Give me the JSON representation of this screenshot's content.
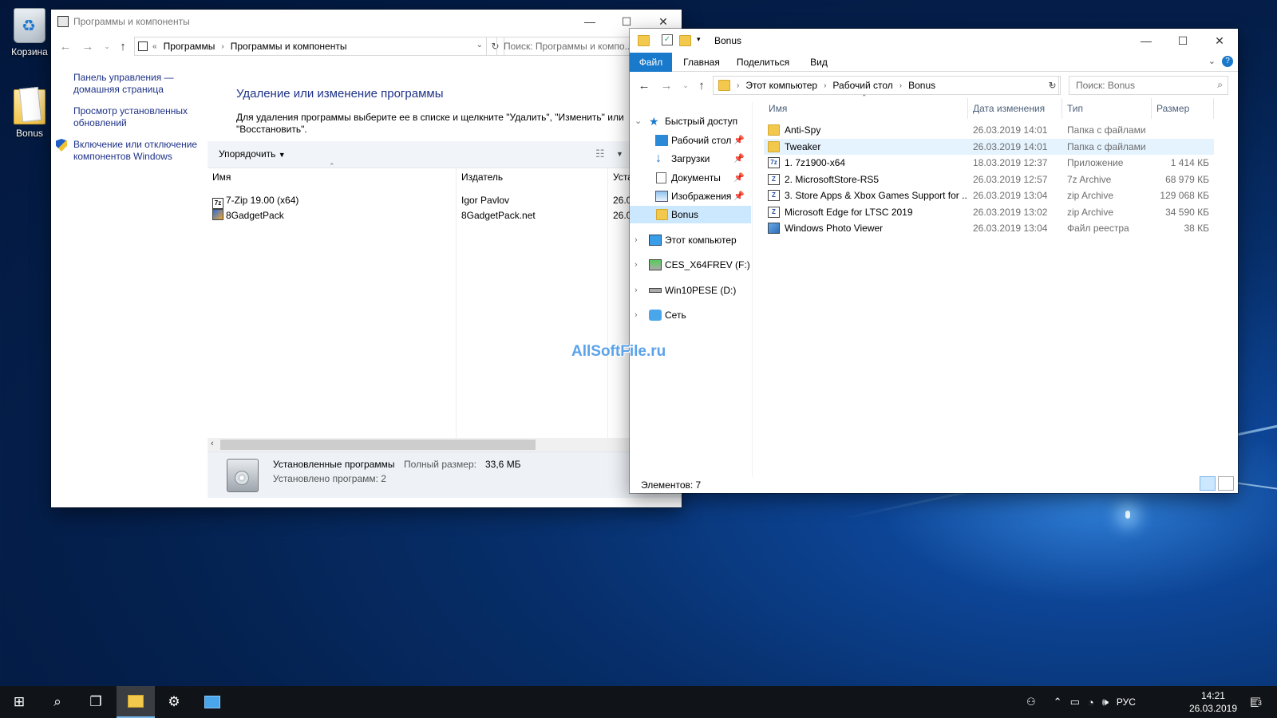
{
  "desktop": {
    "icons": [
      {
        "label": "Корзина"
      },
      {
        "label": "Bonus"
      }
    ],
    "watermark": "AllSoftFile.ru"
  },
  "control_panel": {
    "title": "Программы и компоненты",
    "breadcrumb": [
      "Программы",
      "Программы и компоненты"
    ],
    "search_placeholder": "Поиск: Программы и компо...",
    "links": [
      "Панель управления — домашняя страница",
      "Просмотр установленных обновлений",
      "Включение или отключение компонентов Windows"
    ],
    "heading": "Удаление или изменение программы",
    "description": "Для удаления программы выберите ее в списке и щелкните \"Удалить\", \"Изменить\" или \"Восстановить\".",
    "organize_label": "Упорядочить",
    "columns": [
      "Имя",
      "Издатель",
      "Уста"
    ],
    "programs": [
      {
        "name": "7-Zip 19.00 (x64)",
        "publisher": "Igor Pavlov",
        "installed": "26.0"
      },
      {
        "name": "8GadgetPack",
        "publisher": "8GadgetPack.net",
        "installed": "26.0"
      }
    ],
    "status": {
      "title": "Установленные программы",
      "size_label": "Полный размер:",
      "size_value": "33,6 МБ",
      "count_text": "Установлено программ: 2"
    }
  },
  "explorer": {
    "title": "Bonus",
    "ribbon_tabs": [
      "Файл",
      "Главная",
      "Поделиться",
      "Вид"
    ],
    "breadcrumb": [
      "Этот компьютер",
      "Рабочий стол",
      "Bonus"
    ],
    "search_placeholder": "Поиск: Bonus",
    "nav": {
      "quick_access": "Быстрый доступ",
      "quick_items": [
        "Рабочий стол",
        "Загрузки",
        "Документы",
        "Изображения",
        "Bonus"
      ],
      "this_pc": "Этот компьютер",
      "drive_f": "CES_X64FREV (F:)",
      "drive_d": "Win10PESE (D:)",
      "network": "Сеть"
    },
    "columns": [
      "Имя",
      "Дата изменения",
      "Тип",
      "Размер"
    ],
    "files": [
      {
        "name": "Anti-Spy",
        "date": "26.03.2019 14:01",
        "type": "Папка с файлами",
        "size": "",
        "icon": "folder"
      },
      {
        "name": "Tweaker",
        "date": "26.03.2019 14:01",
        "type": "Папка с файлами",
        "size": "",
        "icon": "folder"
      },
      {
        "name": "1. 7z1900-x64",
        "date": "18.03.2019 12:37",
        "type": "Приложение",
        "size": "1 414 КБ",
        "icon": "7z-app"
      },
      {
        "name": "2. MicrosoftStore-RS5",
        "date": "26.03.2019 12:57",
        "type": "7z Archive",
        "size": "68 979 КБ",
        "icon": "archive"
      },
      {
        "name": "3. Store Apps & Xbox Games Support for ...",
        "date": "26.03.2019 13:04",
        "type": "zip Archive",
        "size": "129 068 КБ",
        "icon": "archive"
      },
      {
        "name": "Microsoft Edge for LTSC 2019",
        "date": "26.03.2019 13:02",
        "type": "zip Archive",
        "size": "34 590 КБ",
        "icon": "archive"
      },
      {
        "name": "Windows Photo Viewer",
        "date": "26.03.2019 13:04",
        "type": "Файл реестра",
        "size": "38 КБ",
        "icon": "registry"
      }
    ],
    "status": "Элементов: 7"
  },
  "taskbar": {
    "language": "РУС",
    "time": "14:21",
    "date": "26.03.2019",
    "notifications": "3"
  },
  "colors": {
    "accent": "#1979ca",
    "link": "#1e3287",
    "selection": "#cce8ff"
  }
}
